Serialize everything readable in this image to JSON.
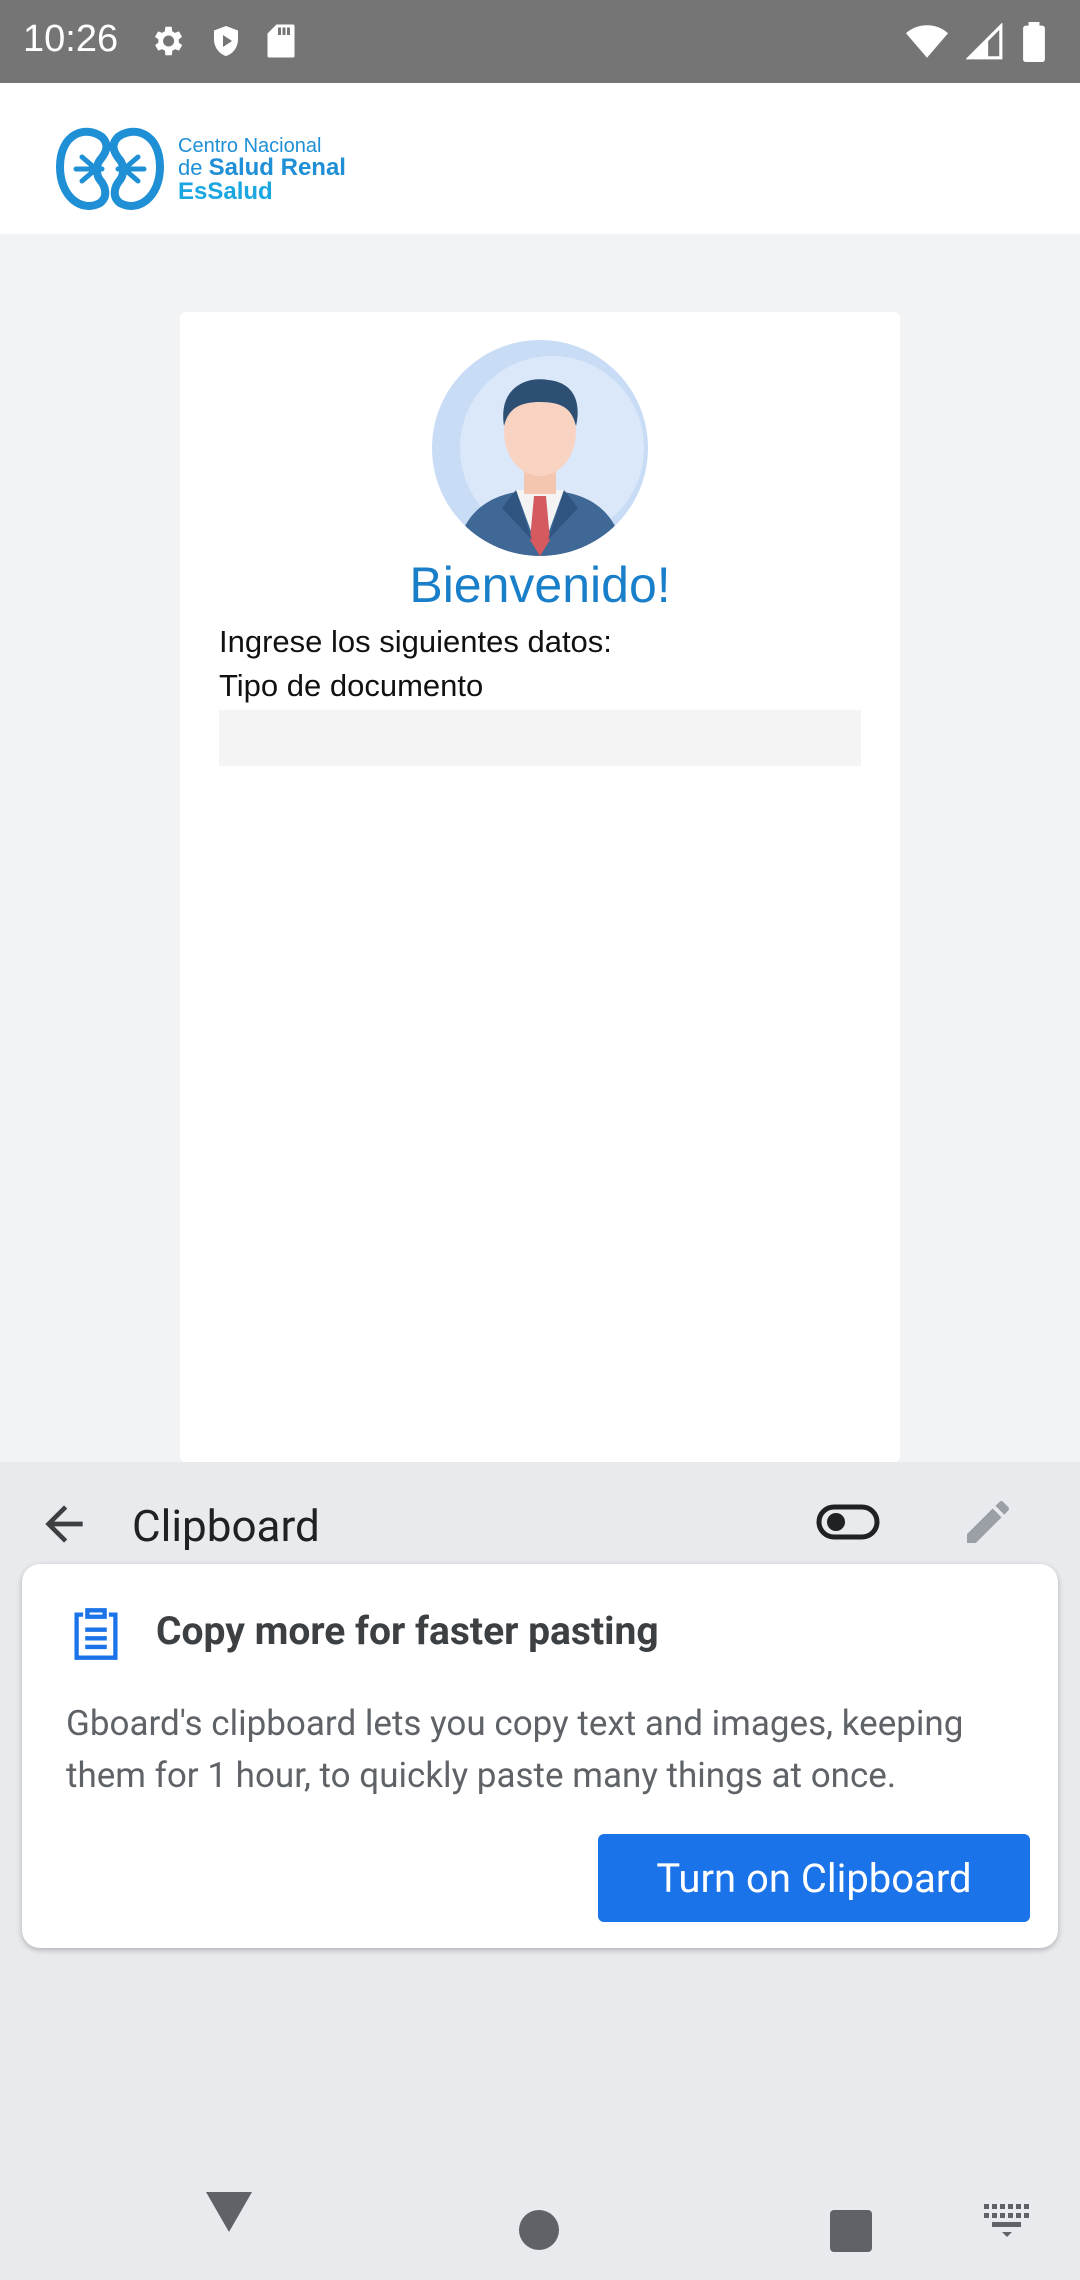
{
  "status_bar": {
    "time": "10:26",
    "left_icons": [
      "settings-icon",
      "play-protect-icon",
      "sd-card-icon"
    ],
    "right_icons": [
      "wifi-icon",
      "cell-signal-icon",
      "battery-icon"
    ]
  },
  "app": {
    "logo": {
      "line1": "Centro Nacional",
      "line2_prefix": "de ",
      "line2_bold": "Salud Renal",
      "line3": "EsSalud"
    },
    "card": {
      "welcome": "Bienvenido!",
      "instruction": "Ingrese los siguientes datos:",
      "doc_type_label": "Tipo de documento",
      "doc_type_value": ""
    }
  },
  "keyboard": {
    "title": "Clipboard",
    "tooltip": {
      "title": "Copy more for faster pasting",
      "body": "Gboard's clipboard lets you copy text and images, keeping them for 1 hour, to quickly paste many things at once.",
      "button": "Turn on Clipboard"
    },
    "colors": {
      "accent": "#1a73e8",
      "background": "#e8eaed"
    }
  },
  "nav_bar": {
    "buttons": [
      "back-icon",
      "home-icon",
      "recents-icon",
      "keyboard-switch-icon"
    ]
  }
}
